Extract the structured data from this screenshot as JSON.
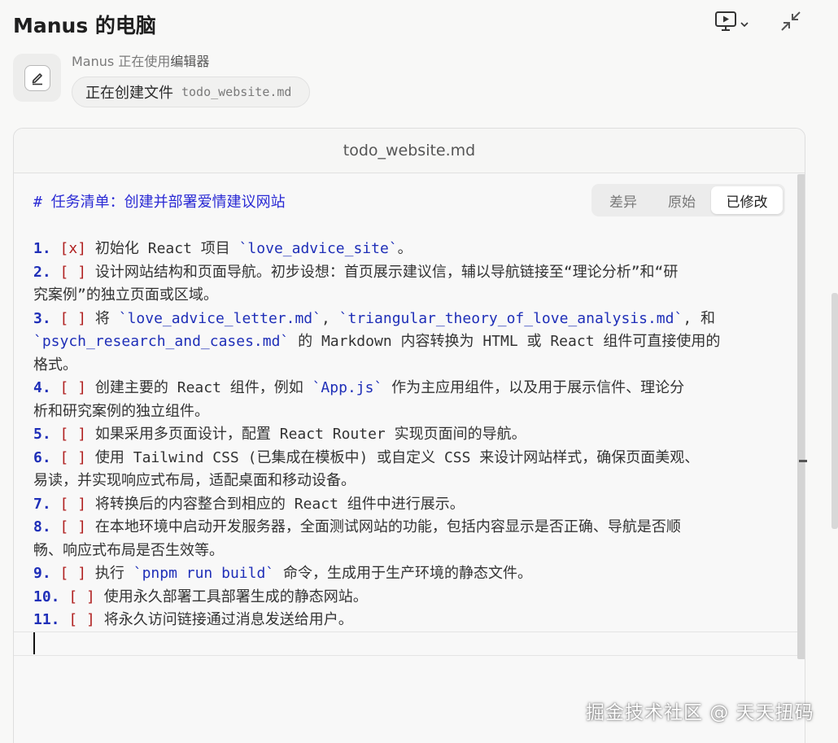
{
  "window": {
    "title": "Manus 的电脑"
  },
  "activity": {
    "status_prefix": "Manus 正在使用",
    "status_tool": "编辑器",
    "action": "正在创建文件",
    "filename": "todo_website.md"
  },
  "panel": {
    "file_title": "todo_website.md",
    "tabs": [
      {
        "label": "差异",
        "active": false
      },
      {
        "label": "原始",
        "active": false
      },
      {
        "label": "已修改",
        "active": true
      }
    ]
  },
  "document": {
    "heading": "# 任务清单：创建并部署爱情建议网站",
    "items": [
      {
        "num": "1.",
        "check": "[x]",
        "lines": [
          "初始化 React 项目 `love_advice_site`。"
        ]
      },
      {
        "num": "2.",
        "check": "[ ]",
        "lines": [
          "设计网站结构和页面导航。初步设想：首页展示建议信，辅以导航链接至“理论分析”和“研",
          "究案例”的独立页面或区域。"
        ]
      },
      {
        "num": "3.",
        "check": "[ ]",
        "lines": [
          "将 `love_advice_letter.md`, `triangular_theory_of_love_analysis.md`, 和",
          "`psych_research_and_cases.md` 的 Markdown 内容转换为 HTML 或 React 组件可直接使用的",
          "格式。"
        ]
      },
      {
        "num": "4.",
        "check": "[ ]",
        "lines": [
          "创建主要的 React 组件，例如 `App.js` 作为主应用组件，以及用于展示信件、理论分",
          "析和研究案例的独立组件。"
        ]
      },
      {
        "num": "5.",
        "check": "[ ]",
        "lines": [
          "如果采用多页面设计，配置 React Router 实现页面间的导航。"
        ]
      },
      {
        "num": "6.",
        "check": "[ ]",
        "lines": [
          "使用 Tailwind CSS (已集成在模板中) 或自定义 CSS 来设计网站样式，确保页面美观、",
          "易读，并实现响应式布局，适配桌面和移动设备。"
        ]
      },
      {
        "num": "7.",
        "check": "[ ]",
        "lines": [
          "将转换后的内容整合到相应的 React 组件中进行展示。"
        ]
      },
      {
        "num": "8.",
        "check": "[ ]",
        "lines": [
          "在本地环境中启动开发服务器，全面测试网站的功能，包括内容显示是否正确、导航是否顺",
          "畅、响应式布局是否生效等。"
        ]
      },
      {
        "num": "9.",
        "check": "[ ]",
        "lines": [
          "执行 `pnpm run build` 命令，生成用于生产环境的静态文件。"
        ]
      },
      {
        "num": "10.",
        "check": "[ ]",
        "lines": [
          "使用永久部署工具部署生成的静态网站。"
        ]
      },
      {
        "num": "11.",
        "check": "[ ]",
        "lines": [
          "将永久访问链接通过消息发送给用户。"
        ]
      }
    ]
  },
  "watermark": "掘金技术社区 @ 天天扭码",
  "icons": {
    "screen": "monitor-play-icon",
    "dropdown": "chevron-down-icon",
    "collapse": "collapse-arrows-icon",
    "editor": "pencil-edit-icon"
  },
  "colors": {
    "heading": "#2a2ad4",
    "list_number": "#1f2fb8",
    "checkbox": "#b02020",
    "background": "#f8f8f7"
  }
}
